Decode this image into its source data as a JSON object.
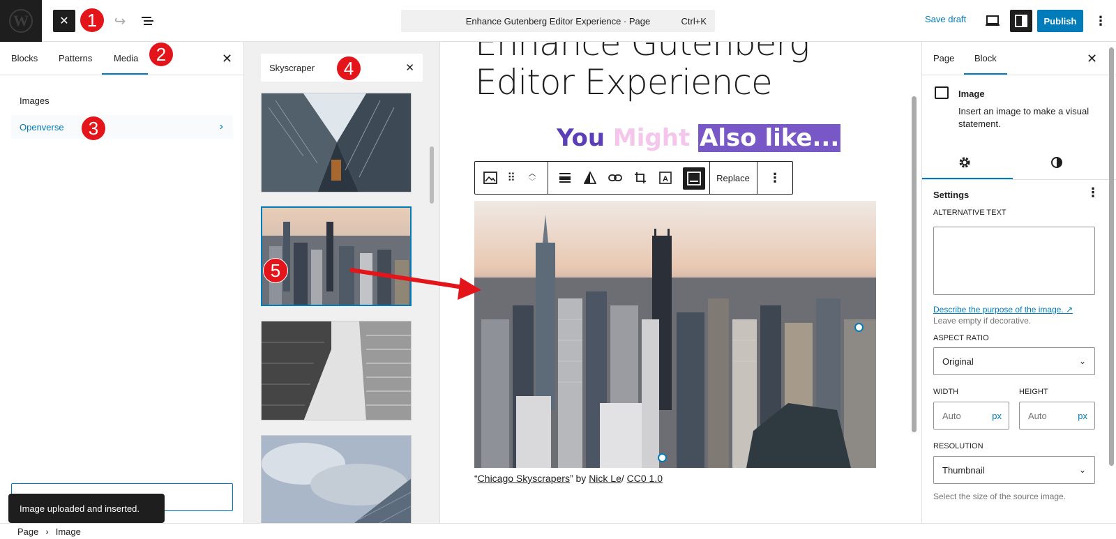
{
  "topbar": {
    "command_title": "Enhance Gutenberg Editor Experience · Page",
    "command_shortcut": "Ctrl+K",
    "save_draft": "Save draft",
    "publish": "Publish"
  },
  "badges": [
    "1",
    "2",
    "3",
    "4",
    "5"
  ],
  "inserter": {
    "tabs": [
      "Blocks",
      "Patterns",
      "Media"
    ],
    "active_tab": "Media",
    "categories": [
      {
        "label": "Images",
        "selected": false
      },
      {
        "label": "Openverse",
        "selected": true
      }
    ]
  },
  "snackbar": "Image uploaded and inserted.",
  "media": {
    "search_value": "Skyscraper",
    "selected_index": 1
  },
  "canvas": {
    "title_line1": "Enhance Gutenberg",
    "title_line2": "Editor Experience",
    "heading_word1": "You",
    "heading_word2": "Might",
    "heading_word3": "Also like...",
    "toolbar_replace": "Replace",
    "caption": {
      "open_quote": "“",
      "title": "Chicago Skyscrapers",
      "by": "” by ",
      "author": "Nick Le",
      "slash": "/ ",
      "license": "CC0 1.0"
    }
  },
  "sidebar": {
    "tabs": [
      "Page",
      "Block"
    ],
    "active_tab": "Block",
    "block_title": "Image",
    "block_description": "Insert an image to make a visual statement.",
    "settings_title": "Settings",
    "alt_text_label": "ALTERNATIVE TEXT",
    "alt_text_link": "Describe the purpose of the image.",
    "alt_text_help": "Leave empty if decorative.",
    "aspect_ratio_label": "ASPECT RATIO",
    "aspect_ratio_value": "Original",
    "width_label": "WIDTH",
    "height_label": "HEIGHT",
    "width_placeholder": "Auto",
    "height_placeholder": "Auto",
    "unit": "px",
    "resolution_label": "RESOLUTION",
    "resolution_value": "Thumbnail",
    "resolution_help": "Select the size of the source image."
  },
  "breadcrumbs": [
    "Page",
    "Image"
  ],
  "colors": {
    "accent": "#007cba",
    "badge": "#e3151a",
    "heading_purple": "#5b3fb8",
    "heading_pink": "#f4c6ec",
    "heading_highlight": "#7858c6"
  }
}
